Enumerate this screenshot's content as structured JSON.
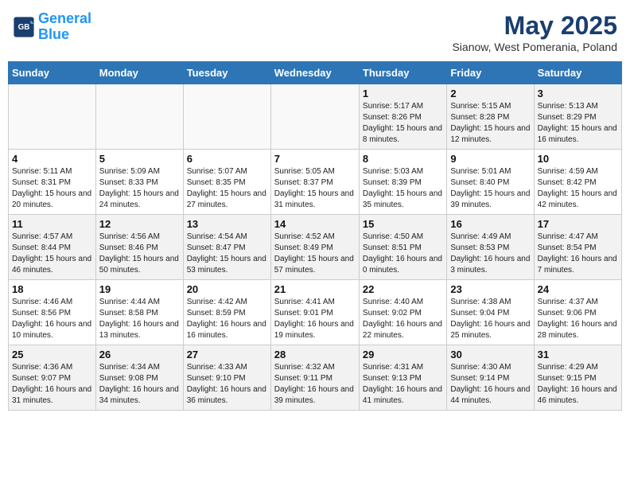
{
  "logo": {
    "line1": "General",
    "line2": "Blue"
  },
  "title": "May 2025",
  "subtitle": "Sianow, West Pomerania, Poland",
  "days_of_week": [
    "Sunday",
    "Monday",
    "Tuesday",
    "Wednesday",
    "Thursday",
    "Friday",
    "Saturday"
  ],
  "weeks": [
    [
      {
        "day": "",
        "info": ""
      },
      {
        "day": "",
        "info": ""
      },
      {
        "day": "",
        "info": ""
      },
      {
        "day": "",
        "info": ""
      },
      {
        "day": "1",
        "info": "Sunrise: 5:17 AM\nSunset: 8:26 PM\nDaylight: 15 hours and 8 minutes."
      },
      {
        "day": "2",
        "info": "Sunrise: 5:15 AM\nSunset: 8:28 PM\nDaylight: 15 hours and 12 minutes."
      },
      {
        "day": "3",
        "info": "Sunrise: 5:13 AM\nSunset: 8:29 PM\nDaylight: 15 hours and 16 minutes."
      }
    ],
    [
      {
        "day": "4",
        "info": "Sunrise: 5:11 AM\nSunset: 8:31 PM\nDaylight: 15 hours and 20 minutes."
      },
      {
        "day": "5",
        "info": "Sunrise: 5:09 AM\nSunset: 8:33 PM\nDaylight: 15 hours and 24 minutes."
      },
      {
        "day": "6",
        "info": "Sunrise: 5:07 AM\nSunset: 8:35 PM\nDaylight: 15 hours and 27 minutes."
      },
      {
        "day": "7",
        "info": "Sunrise: 5:05 AM\nSunset: 8:37 PM\nDaylight: 15 hours and 31 minutes."
      },
      {
        "day": "8",
        "info": "Sunrise: 5:03 AM\nSunset: 8:39 PM\nDaylight: 15 hours and 35 minutes."
      },
      {
        "day": "9",
        "info": "Sunrise: 5:01 AM\nSunset: 8:40 PM\nDaylight: 15 hours and 39 minutes."
      },
      {
        "day": "10",
        "info": "Sunrise: 4:59 AM\nSunset: 8:42 PM\nDaylight: 15 hours and 42 minutes."
      }
    ],
    [
      {
        "day": "11",
        "info": "Sunrise: 4:57 AM\nSunset: 8:44 PM\nDaylight: 15 hours and 46 minutes."
      },
      {
        "day": "12",
        "info": "Sunrise: 4:56 AM\nSunset: 8:46 PM\nDaylight: 15 hours and 50 minutes."
      },
      {
        "day": "13",
        "info": "Sunrise: 4:54 AM\nSunset: 8:47 PM\nDaylight: 15 hours and 53 minutes."
      },
      {
        "day": "14",
        "info": "Sunrise: 4:52 AM\nSunset: 8:49 PM\nDaylight: 15 hours and 57 minutes."
      },
      {
        "day": "15",
        "info": "Sunrise: 4:50 AM\nSunset: 8:51 PM\nDaylight: 16 hours and 0 minutes."
      },
      {
        "day": "16",
        "info": "Sunrise: 4:49 AM\nSunset: 8:53 PM\nDaylight: 16 hours and 3 minutes."
      },
      {
        "day": "17",
        "info": "Sunrise: 4:47 AM\nSunset: 8:54 PM\nDaylight: 16 hours and 7 minutes."
      }
    ],
    [
      {
        "day": "18",
        "info": "Sunrise: 4:46 AM\nSunset: 8:56 PM\nDaylight: 16 hours and 10 minutes."
      },
      {
        "day": "19",
        "info": "Sunrise: 4:44 AM\nSunset: 8:58 PM\nDaylight: 16 hours and 13 minutes."
      },
      {
        "day": "20",
        "info": "Sunrise: 4:42 AM\nSunset: 8:59 PM\nDaylight: 16 hours and 16 minutes."
      },
      {
        "day": "21",
        "info": "Sunrise: 4:41 AM\nSunset: 9:01 PM\nDaylight: 16 hours and 19 minutes."
      },
      {
        "day": "22",
        "info": "Sunrise: 4:40 AM\nSunset: 9:02 PM\nDaylight: 16 hours and 22 minutes."
      },
      {
        "day": "23",
        "info": "Sunrise: 4:38 AM\nSunset: 9:04 PM\nDaylight: 16 hours and 25 minutes."
      },
      {
        "day": "24",
        "info": "Sunrise: 4:37 AM\nSunset: 9:06 PM\nDaylight: 16 hours and 28 minutes."
      }
    ],
    [
      {
        "day": "25",
        "info": "Sunrise: 4:36 AM\nSunset: 9:07 PM\nDaylight: 16 hours and 31 minutes."
      },
      {
        "day": "26",
        "info": "Sunrise: 4:34 AM\nSunset: 9:08 PM\nDaylight: 16 hours and 34 minutes."
      },
      {
        "day": "27",
        "info": "Sunrise: 4:33 AM\nSunset: 9:10 PM\nDaylight: 16 hours and 36 minutes."
      },
      {
        "day": "28",
        "info": "Sunrise: 4:32 AM\nSunset: 9:11 PM\nDaylight: 16 hours and 39 minutes."
      },
      {
        "day": "29",
        "info": "Sunrise: 4:31 AM\nSunset: 9:13 PM\nDaylight: 16 hours and 41 minutes."
      },
      {
        "day": "30",
        "info": "Sunrise: 4:30 AM\nSunset: 9:14 PM\nDaylight: 16 hours and 44 minutes."
      },
      {
        "day": "31",
        "info": "Sunrise: 4:29 AM\nSunset: 9:15 PM\nDaylight: 16 hours and 46 minutes."
      }
    ]
  ]
}
